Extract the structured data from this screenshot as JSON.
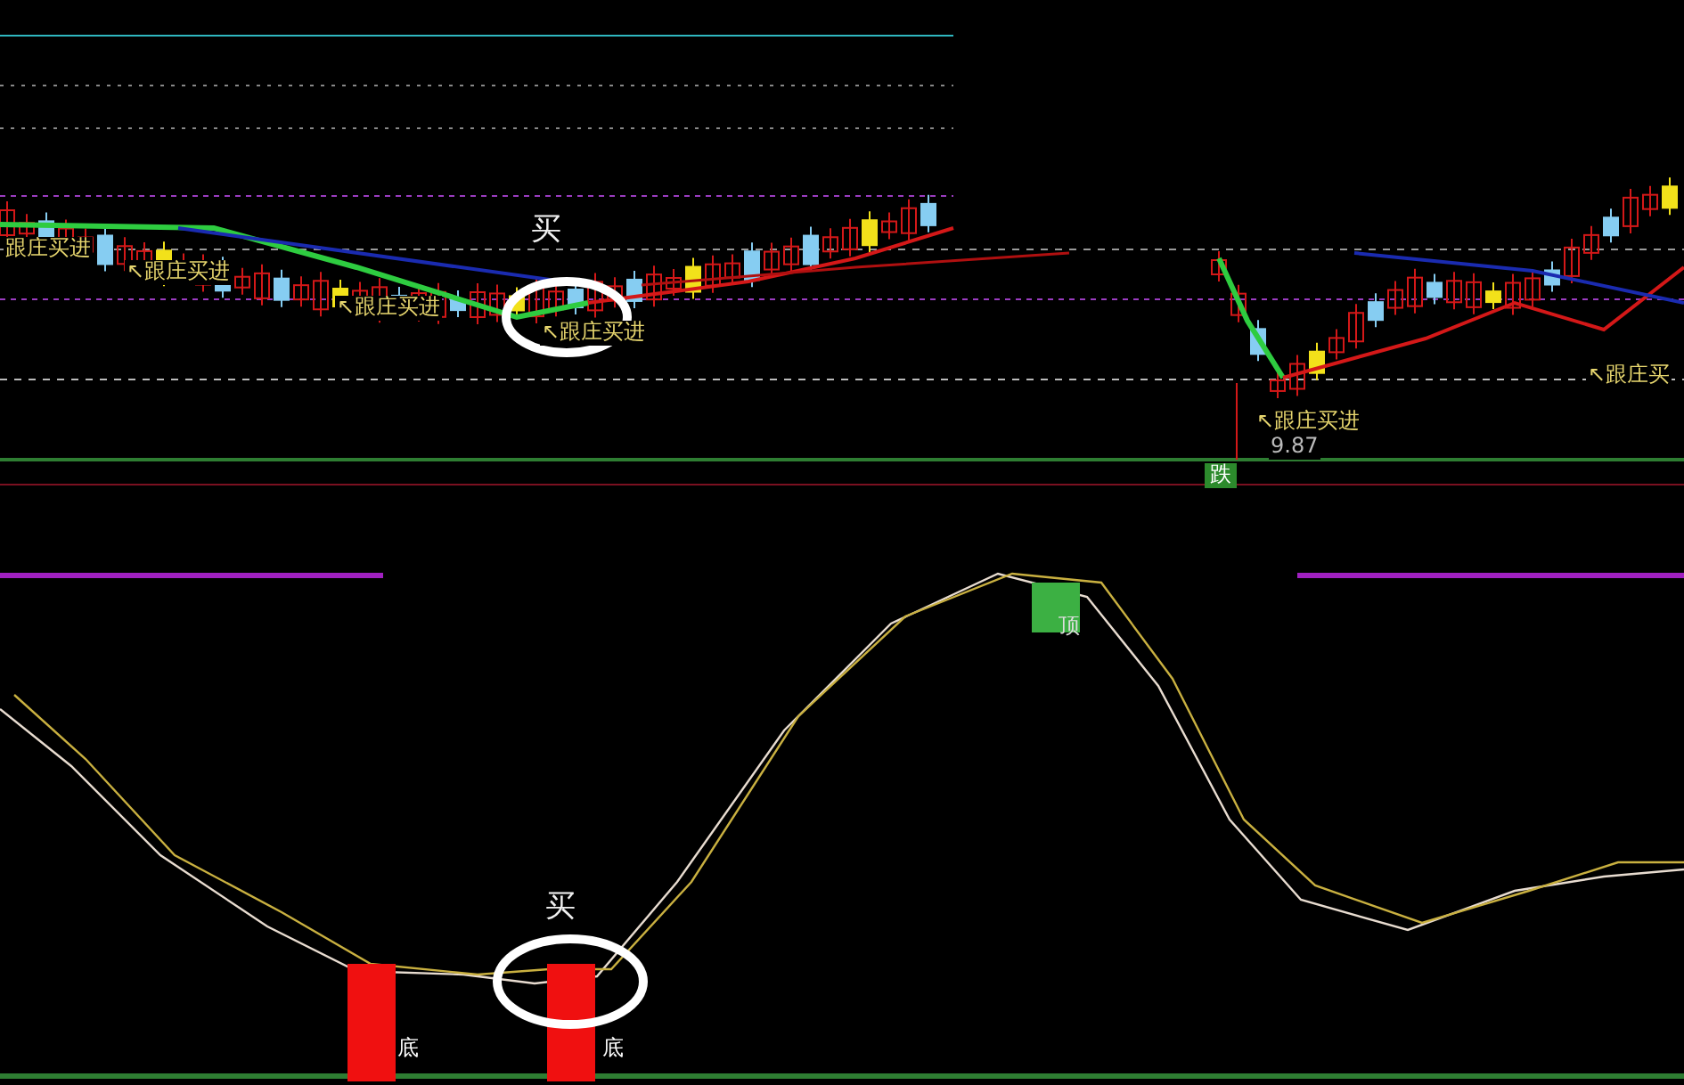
{
  "price_panel": {
    "labels": [
      {
        "text": "跟庄买进",
        "kind": "signal"
      },
      {
        "text": "↖跟庄买进",
        "kind": "signal"
      },
      {
        "text": "↖跟庄买进",
        "kind": "signal"
      },
      {
        "text": "↖跟庄买进",
        "kind": "signal"
      },
      {
        "text": "买",
        "kind": "buy"
      },
      {
        "text": "↖跟庄买进",
        "kind": "signal"
      },
      {
        "text": "↖跟庄买",
        "kind": "signal"
      },
      {
        "text": "9.87",
        "kind": "price"
      },
      {
        "text": "跌",
        "kind": "tag"
      }
    ]
  },
  "indicator_panel": {
    "labels": [
      {
        "text": "顶",
        "kind": "top"
      },
      {
        "text": "买",
        "kind": "buy"
      },
      {
        "text": "底",
        "kind": "bottom"
      },
      {
        "text": "底",
        "kind": "bottom"
      }
    ]
  }
}
